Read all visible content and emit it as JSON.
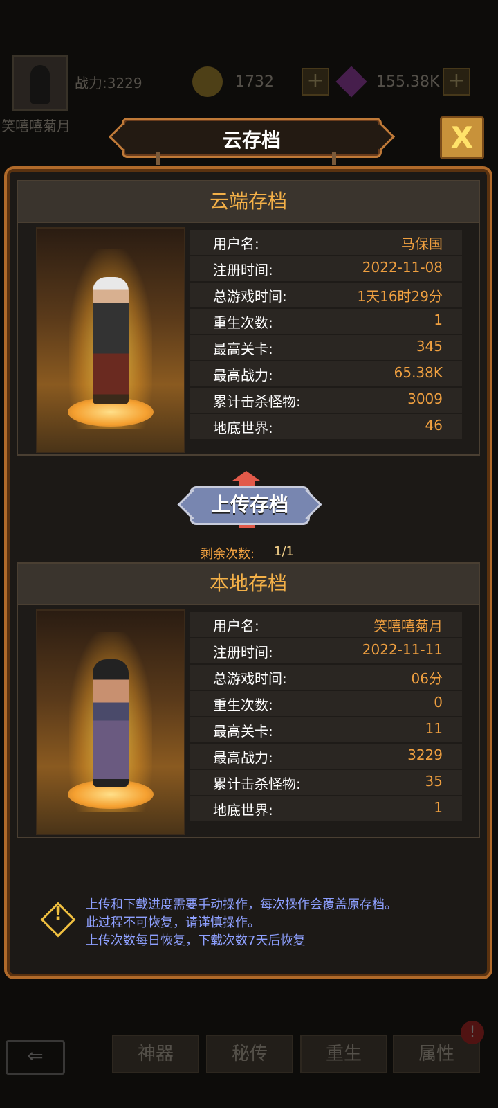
{
  "hud": {
    "player_name": "笑嘻嘻菊月",
    "power": "战力:3229",
    "coins": "1732",
    "gems": "155.38K",
    "icons": {
      "coin": "coin-icon",
      "gem": "gem-icon",
      "plus": "plus-icon"
    }
  },
  "dialog": {
    "title": "云存档",
    "close_label": "X"
  },
  "cloud": {
    "header": "云端存档",
    "rows": [
      {
        "label": "用户名:",
        "value": "马保国"
      },
      {
        "label": "注册时间:",
        "value": "2022-11-08"
      },
      {
        "label": "总游戏时间:",
        "value": "1天16时29分"
      },
      {
        "label": "重生次数:",
        "value": "1"
      },
      {
        "label": "最高关卡:",
        "value": "345"
      },
      {
        "label": "最高战力:",
        "value": "65.38K"
      },
      {
        "label": "累计击杀怪物:",
        "value": "3009"
      },
      {
        "label": "地底世界:",
        "value": "46"
      }
    ]
  },
  "upload": {
    "label": "上传存档",
    "remaining_label": "剩余次数:",
    "remaining_value": "1/1"
  },
  "local": {
    "header": "本地存档",
    "rows": [
      {
        "label": "用户名:",
        "value": "笑嘻嘻菊月"
      },
      {
        "label": "注册时间:",
        "value": "2022-11-11"
      },
      {
        "label": "总游戏时间:",
        "value": "06分"
      },
      {
        "label": "重生次数:",
        "value": "0"
      },
      {
        "label": "最高关卡:",
        "value": "11"
      },
      {
        "label": "最高战力:",
        "value": "3229"
      },
      {
        "label": "累计击杀怪物:",
        "value": "35"
      },
      {
        "label": "地底世界:",
        "value": "1"
      }
    ]
  },
  "warning": {
    "lines": [
      "上传和下载进度需要手动操作，每次操作会覆盖原存档。",
      "此过程不可恢复，请谨慎操作。",
      "上传次数每日恢复，下载次数7天后恢复"
    ]
  },
  "bottom_tabs": [
    {
      "label": "神器"
    },
    {
      "label": "秘传"
    },
    {
      "label": "重生"
    },
    {
      "label": "属性"
    }
  ],
  "badge": "!",
  "colors": {
    "accent": "#f0a040",
    "header": "#f3b048",
    "warning_text": "#8ea0ff",
    "upload_arrow": "#e25a4a"
  }
}
